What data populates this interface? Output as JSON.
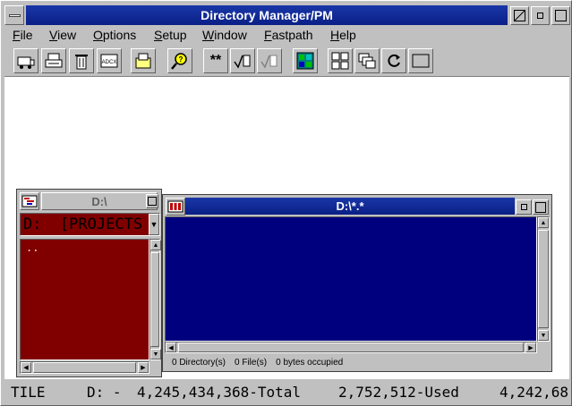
{
  "window": {
    "title": "Directory Manager/PM",
    "controls": {
      "restore": "◩",
      "minimize": "▫",
      "maximize": "□"
    }
  },
  "menu": [
    {
      "label": "File",
      "underline": "F",
      "rest": "ile"
    },
    {
      "label": "View",
      "underline": "V",
      "rest": "iew"
    },
    {
      "label": "Options",
      "underline": "O",
      "rest": "ptions"
    },
    {
      "label": "Setup",
      "underline": "S",
      "rest": "etup"
    },
    {
      "label": "Window",
      "underline": "W",
      "rest": "indow"
    },
    {
      "label": "Fastpath",
      "underline": "F",
      "rest": "astpath"
    },
    {
      "label": "Help",
      "underline": "H",
      "rest": "elp"
    }
  ],
  "toolbar": {
    "icons": [
      "move-icon",
      "print-icon",
      "delete-icon",
      "attributes-icon",
      "open-folder-icon",
      "search-icon",
      "select-all-icon",
      "select-icon",
      "deselect-icon",
      "color-grid-icon",
      "tile-icon",
      "cascade-icon",
      "refresh-icon",
      "blank-icon"
    ],
    "select_all_label": "**",
    "attr_label": "ADCX"
  },
  "drive_window": {
    "title": "D:\\",
    "combo_value": "D:  [PROJECTS",
    "list_items": [
      ".."
    ]
  },
  "file_window": {
    "title": "D:\\*.*",
    "status": {
      "directories": "0 Directory(s)",
      "files": "0 File(s)",
      "bytes": "0 bytes occupied"
    }
  },
  "statusbar": {
    "mode": "TILE",
    "drive": "D: -",
    "total": "4,245,434,368-Total",
    "used": "2,752,512-Used",
    "free": "4,242,68"
  },
  "colors": {
    "title_blue": "#0a1f86",
    "drive_list_bg": "#800000",
    "file_list_bg": "#00007f",
    "frame_gray": "#c0c0c0"
  }
}
